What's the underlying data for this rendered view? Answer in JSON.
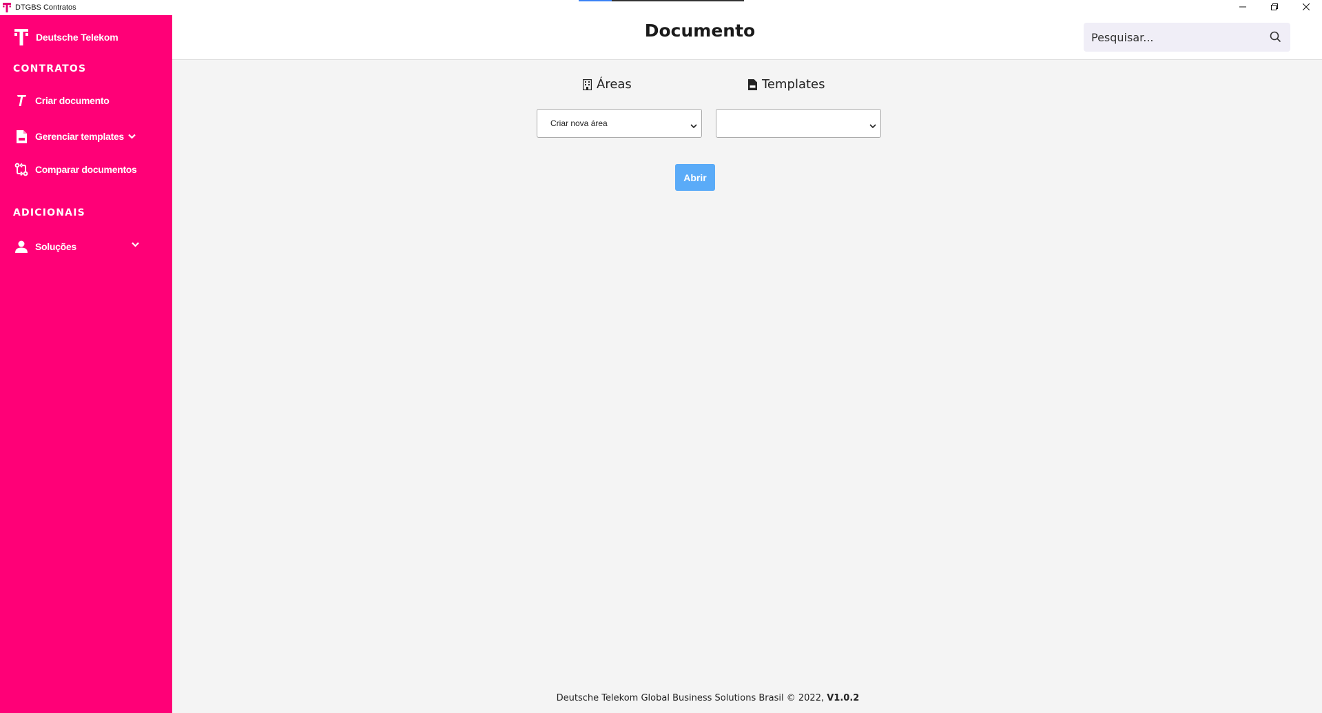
{
  "window": {
    "title": "DTGBS Contratos"
  },
  "sidebar": {
    "brand": "Deutsche Telekom",
    "sections": [
      {
        "title": "CONTRATOS"
      },
      {
        "title": "ADICIONAIS"
      }
    ],
    "items": [
      {
        "label": "Criar documento",
        "icon": "telekom-t-icon"
      },
      {
        "label": "Gerenciar templates",
        "icon": "document-icon",
        "expandable": true
      },
      {
        "label": "Comparar documentos",
        "icon": "compare-icon"
      },
      {
        "label": "Soluções",
        "icon": "user-icon",
        "expandable": true
      }
    ]
  },
  "header": {
    "title": "Documento",
    "search_placeholder": "Pesquisar..."
  },
  "main": {
    "areas_heading": "Áreas",
    "templates_heading": "Templates",
    "areas_selected": "Criar nova área",
    "templates_selected": "",
    "open_label": "Abrir"
  },
  "footer": {
    "text": "Deutsche Telekom Global Business Solutions Brasil © 2022,",
    "version": "V1.0.2"
  },
  "colors": {
    "brand": "#ff0077",
    "button": "#5aabf8",
    "background": "#f4f4f4"
  }
}
